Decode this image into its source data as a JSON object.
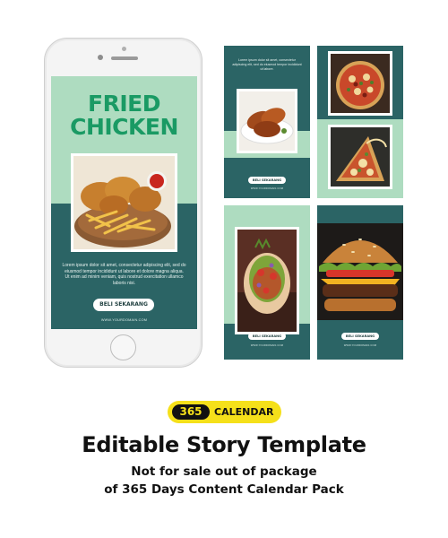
{
  "phone_story": {
    "headline_line1": "FRIED",
    "headline_line2": "CHICKEN",
    "body_text": "Lorem ipsum dolor sit amet, consectetur adipiscing elit, sed do eiusmod tempor incididunt ut labore et dolore magna aliqua. Ut enim ad minim veniam, quis nostrud exercitation ullamco laboris nisi.",
    "cta_label": "BELI SEKARANG",
    "domain": "WWW.YOURDOMAIN.COM"
  },
  "templates": [
    {
      "cta_label": "BELI SEKARANG",
      "domain": "WWW.YOURDOMAIN.COM",
      "body_text": "Lorem ipsum dolor sit amet, consectetur adipiscing elit, sed do eiusmod tempor incididunt ut labore."
    },
    {
      "cta_label": "BELI SEKARANG",
      "domain": "WWW.YOURDOMAIN.COM"
    },
    {
      "cta_label": "BELI SEKARANG",
      "domain": "WWW.YOURDOMAIN.COM"
    }
  ],
  "badge": {
    "number": "365",
    "word": "CALENDAR"
  },
  "caption": {
    "title": "Editable Story Template",
    "line1": "Not for sale out of package",
    "line2": "of 365 Days Content Calendar Pack"
  },
  "colors": {
    "teal": "#2b6465",
    "mint": "#aedcc0",
    "headline_green": "#1a9a64",
    "badge_yellow": "#f5e01a"
  }
}
